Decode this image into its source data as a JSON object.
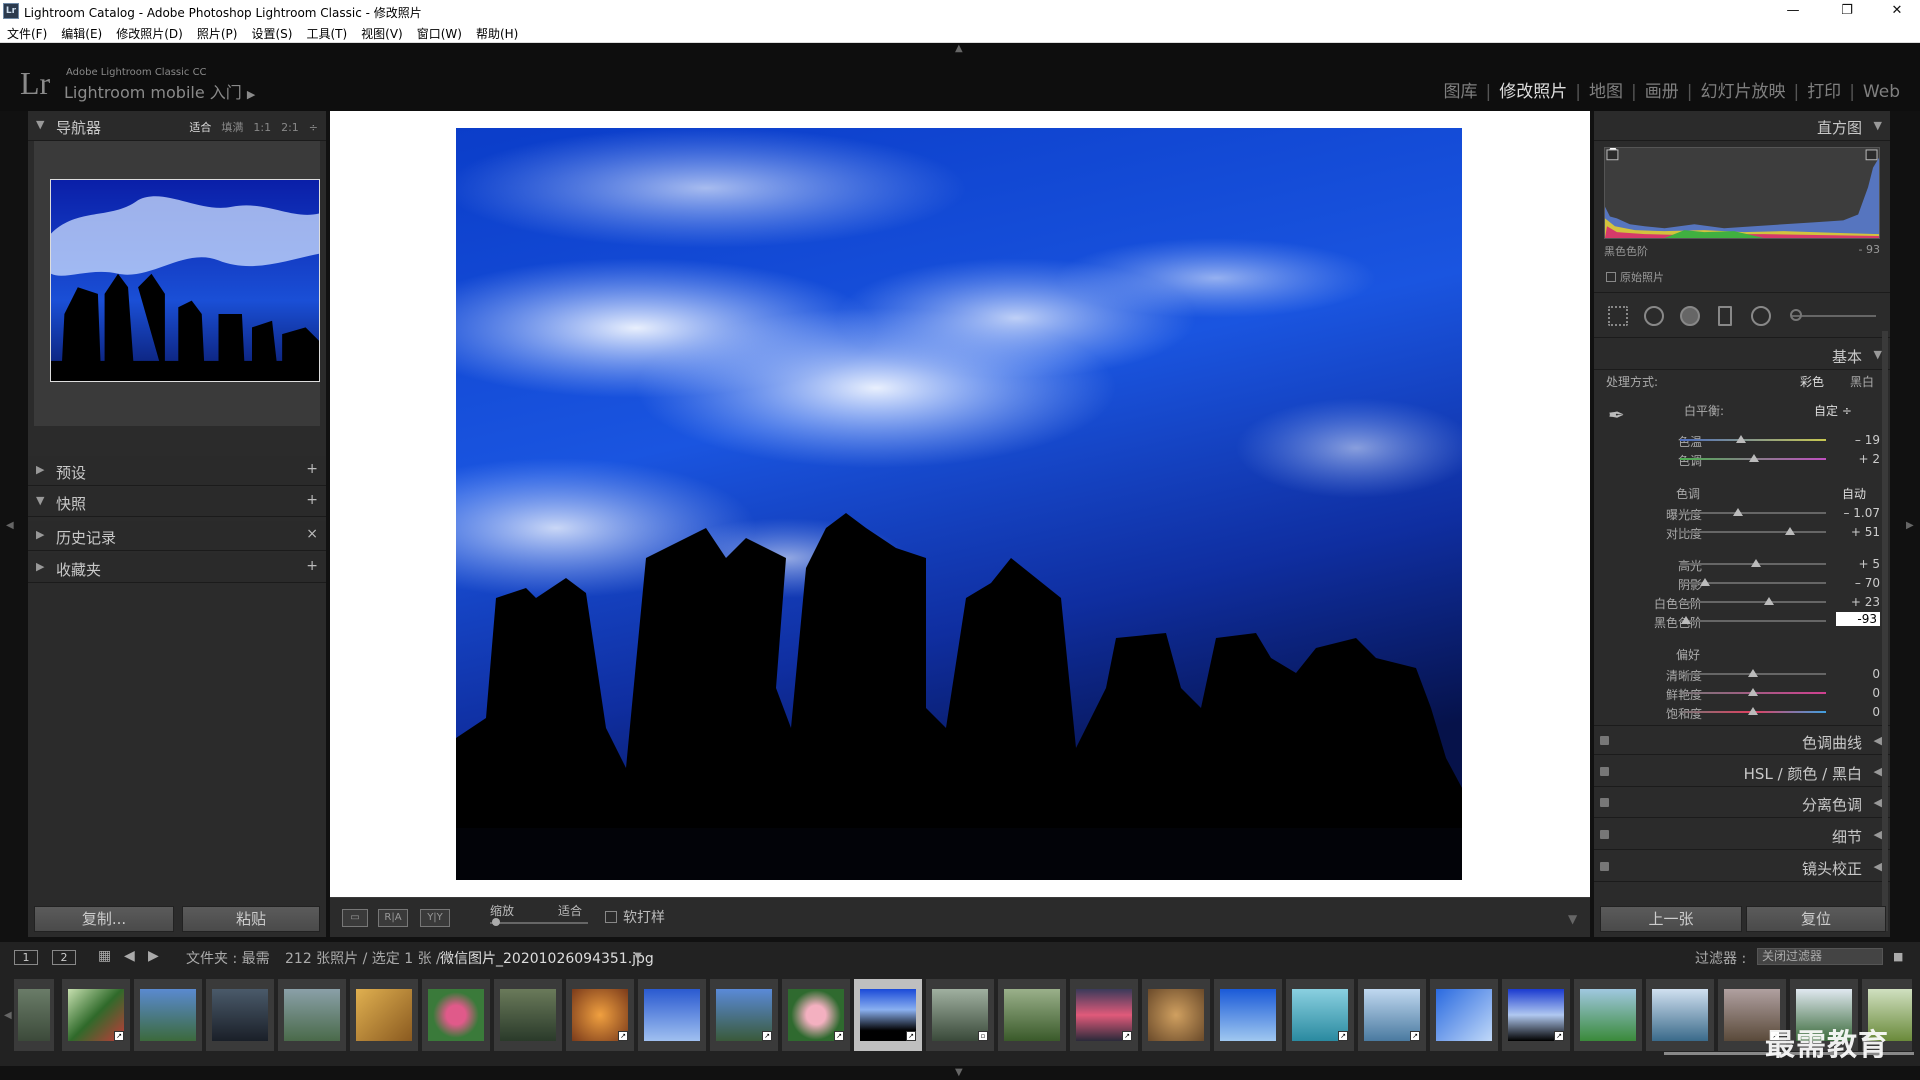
{
  "window": {
    "title": "Lightroom Catalog - Adobe Photoshop Lightroom Classic - 修改照片",
    "minimize": "—",
    "maximize": "❐",
    "close": "✕"
  },
  "menu": [
    "文件(F)",
    "编辑(E)",
    "修改照片(D)",
    "照片(P)",
    "设置(S)",
    "工具(T)",
    "视图(V)",
    "窗口(W)",
    "帮助(H)"
  ],
  "identity": {
    "logo": "Lr",
    "small": "Adobe Lightroom Classic CC",
    "big": "Lightroom mobile 入门",
    "arrow": "▶"
  },
  "modules": [
    "图库",
    "修改照片",
    "地图",
    "画册",
    "幻灯片放映",
    "打印",
    "Web"
  ],
  "active_module": "修改照片",
  "left": {
    "navigator": {
      "title": "导航器",
      "options": [
        "适合",
        "填满",
        "1:1",
        "2:1"
      ],
      "active": "适合"
    },
    "panels": [
      {
        "title": "预设",
        "action": "+"
      },
      {
        "title": "快照",
        "action": "+"
      },
      {
        "title": "历史记录",
        "action": "×"
      },
      {
        "title": "收藏夹",
        "action": "+"
      }
    ],
    "copy_label": "复制...",
    "paste_label": "粘贴"
  },
  "toolbar": {
    "view_ry": "R|A",
    "view_yy": "Y|Y",
    "zoom_label": "缩放",
    "fit_label": "适合",
    "softproof_label": "软打样",
    "zoom_level": 0.02
  },
  "right": {
    "histogram": {
      "title": "直方图",
      "info_label": "黑色色阶",
      "info_value": "- 93",
      "original_label": "原始照片"
    },
    "basic": {
      "title": "基本",
      "treatment_label": "处理方式:",
      "treatment_color": "彩色",
      "treatment_bw": "黑白",
      "wb_label": "白平衡:",
      "wb_value": "自定 ÷",
      "tone_label": "色调",
      "auto_label": "自动",
      "presence_label": "偏好",
      "sliders": [
        {
          "name": "色温",
          "value": "– 19",
          "pos": 0.42
        },
        {
          "name": "色调",
          "value": "+ 2",
          "pos": 0.51
        },
        {
          "name": "曝光度",
          "value": "– 1.07",
          "pos": 0.4
        },
        {
          "name": "对比度",
          "value": "+ 51",
          "pos": 0.75
        },
        {
          "name": "高光",
          "value": "+ 5",
          "pos": 0.52
        },
        {
          "name": "阴影",
          "value": "– 70",
          "pos": 0.17
        },
        {
          "name": "白色色阶",
          "value": "+ 23",
          "pos": 0.61
        },
        {
          "name": "黑色色阶",
          "value": "-93",
          "pos": 0.04
        },
        {
          "name": "清晰度",
          "value": "0",
          "pos": 0.5
        },
        {
          "name": "鲜艳度",
          "value": "0",
          "pos": 0.5
        },
        {
          "name": "饱和度",
          "value": "0",
          "pos": 0.5
        }
      ]
    },
    "panels": [
      {
        "title": "色调曲线"
      },
      {
        "title": "HSL  /  颜色  /  黑白"
      },
      {
        "title": "分离色调"
      },
      {
        "title": "细节"
      },
      {
        "title": "镜头校正"
      }
    ],
    "prev_label": "上一张",
    "reset_label": "复位"
  },
  "filmstrip_bar": {
    "view1": "1",
    "view2": "2",
    "folder_label": "文件夹 : 最需",
    "count_label": "212 张照片 / 选定 1 张 /",
    "filename": "微信图片_20201026094351.jpg",
    "filter_label": "过滤器 :",
    "filter_value": "关闭过滤器"
  },
  "colors": {
    "accent": "#bfbfbf",
    "panel": "#2b2b2b",
    "background": "#111111"
  },
  "watermark": "最需教育"
}
